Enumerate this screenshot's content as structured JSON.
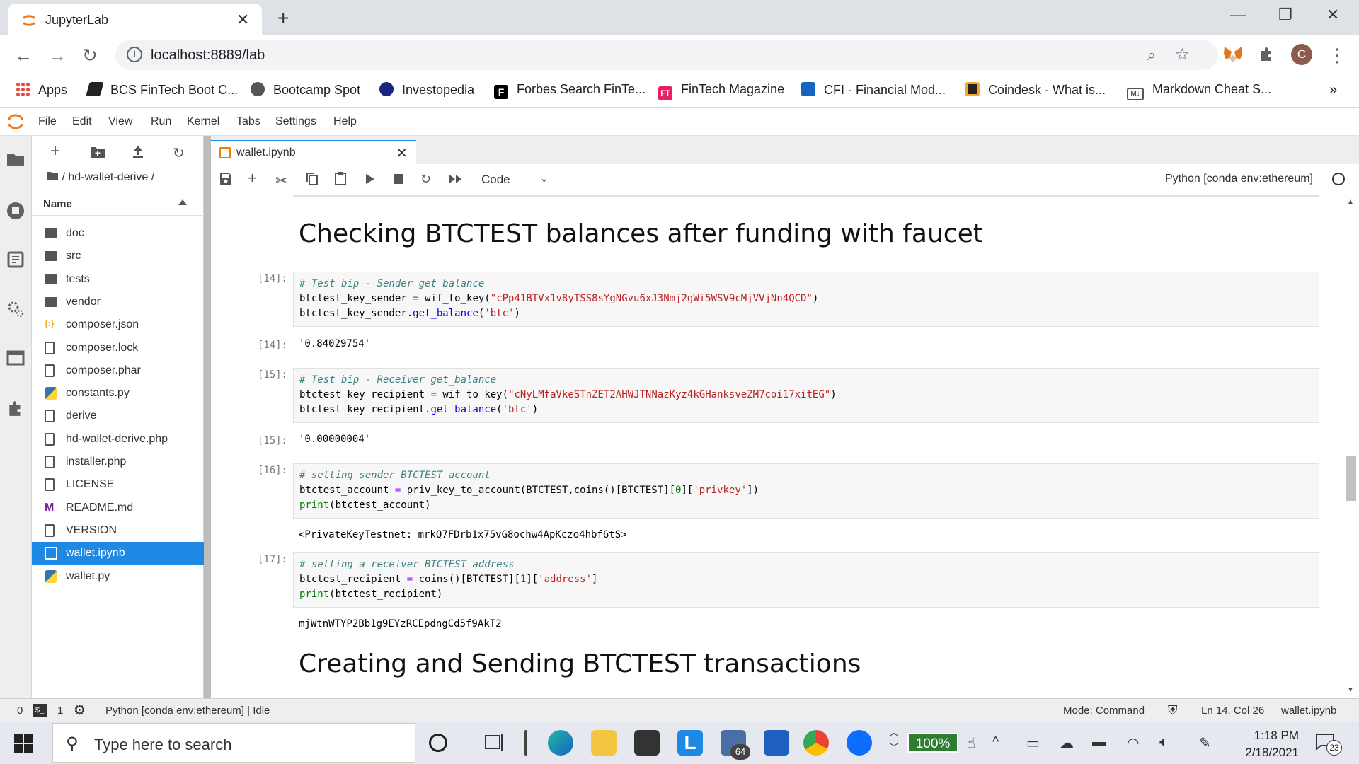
{
  "browser": {
    "tab_title": "JupyterLab",
    "tab_close": "✕",
    "new_tab": "+",
    "window_controls": [
      "—",
      "❐",
      "✕"
    ],
    "url": "localhost:8889/lab",
    "profile_initial": "C",
    "bookmarks": [
      {
        "label": "Apps",
        "color": "#4285f4"
      },
      {
        "label": "BCS FinTech Boot C...",
        "color": "#222222"
      },
      {
        "label": "Bootcamp Spot",
        "color": "#444444"
      },
      {
        "label": "Investopedia",
        "color": "#1a237e"
      },
      {
        "label": "Forbes Search FinTe...",
        "color": "#000000"
      },
      {
        "label": "FinTech Magazine",
        "color": "#e91e63"
      },
      {
        "label": "CFI - Financial Mod...",
        "color": "#1565c0"
      },
      {
        "label": "Coindesk - What is...",
        "color": "#f9a825"
      },
      {
        "label": "Markdown Cheat S...",
        "color": "#555555"
      }
    ],
    "bookmarks_more": "»"
  },
  "jupyter": {
    "menu": [
      "File",
      "Edit",
      "View",
      "Run",
      "Kernel",
      "Tabs",
      "Settings",
      "Help"
    ],
    "breadcrumb": "/ hd-wallet-derive /",
    "file_header": "Name",
    "files": [
      {
        "name": "doc",
        "type": "folder"
      },
      {
        "name": "src",
        "type": "folder"
      },
      {
        "name": "tests",
        "type": "folder"
      },
      {
        "name": "vendor",
        "type": "folder"
      },
      {
        "name": "composer.json",
        "type": "json"
      },
      {
        "name": "composer.lock",
        "type": "file"
      },
      {
        "name": "composer.phar",
        "type": "file"
      },
      {
        "name": "constants.py",
        "type": "python"
      },
      {
        "name": "derive",
        "type": "file"
      },
      {
        "name": "hd-wallet-derive.php",
        "type": "file"
      },
      {
        "name": "installer.php",
        "type": "file"
      },
      {
        "name": "LICENSE",
        "type": "file"
      },
      {
        "name": "README.md",
        "type": "markdown"
      },
      {
        "name": "VERSION",
        "type": "file"
      },
      {
        "name": "wallet.ipynb",
        "type": "notebook",
        "selected": true
      },
      {
        "name": "wallet.py",
        "type": "python"
      }
    ],
    "notebook_tab": "wallet.ipynb",
    "cell_type": "Code",
    "kernel": "Python [conda env:ethereum]",
    "heading1": "Checking BTCTEST balances after funding with faucet",
    "heading2": "Creating and Sending BTCTEST transactions",
    "cells": {
      "c14": {
        "prompt_in": "[14]:",
        "comment": "# Test bip - Sender get_balance",
        "line2_var": "btctest_key_sender",
        "line2_func": "wif_to_key",
        "line2_str": "\"cPp41BTVx1v8yTSS8sYgNGvu6xJ3Nmj2gWi5WSV9cMjVVjNn4QCD\"",
        "line3_obj": "btctest_key_sender.",
        "line3_func": "get_balance",
        "line3_str": "'btc'",
        "prompt_out": "[14]:",
        "output": "'0.84029754'"
      },
      "c15": {
        "prompt_in": "[15]:",
        "comment": "# Test bip - Receiver get_balance",
        "line2_var": "btctest_key_recipient",
        "line2_func": "wif_to_key",
        "line2_str": "\"cNyLMfaVkeSTnZET2AHWJTNNazKyz4kGHanksveZM7coi17xitEG\"",
        "line3_obj": "btctest_key_recipient.",
        "line3_func": "get_balance",
        "line3_str": "'btc'",
        "prompt_out": "[15]:",
        "output": "'0.00000004'"
      },
      "c16": {
        "prompt_in": "[16]:",
        "comment": "# setting sender BTCTEST account",
        "line2_pre": "btctest_account ",
        "line2_mid": " priv_key_to_account(BTCTEST,coins()[BTCTEST][",
        "line2_num": "0",
        "line2_post1": "][",
        "line2_str": "'privkey'",
        "line2_post2": "])",
        "line3_kw": "print",
        "line3_rest": "(btctest_account)",
        "output": "<PrivateKeyTestnet: mrkQ7FDrb1x75vG8ochw4ApKczo4hbf6tS>"
      },
      "c17": {
        "prompt_in": "[17]:",
        "comment": "# setting a receiver BTCTEST address",
        "line2_pre": "btctest_recipient ",
        "line2_mid": " coins()[BTCTEST][",
        "line2_num": "1",
        "line2_post1": "][",
        "line2_str": "'address'",
        "line2_post2": "]",
        "line3_kw": "print",
        "line3_rest": "(btctest_recipient)",
        "output": "mjWtnWTYP2Bb1g9EYzRCEpdngCd5f9AkT2"
      }
    },
    "status": {
      "zero": "0",
      "one": "1",
      "kernel_status": "Python [conda env:ethereum] | Idle",
      "mode": "Mode: Command",
      "position": "Ln 14, Col 26",
      "file": "wallet.ipynb"
    }
  },
  "taskbar": {
    "search_placeholder": "Type here to search",
    "zoom": "100%",
    "mail_badge": "64",
    "time": "1:18 PM",
    "date": "2/18/2021",
    "notifications": "23"
  }
}
